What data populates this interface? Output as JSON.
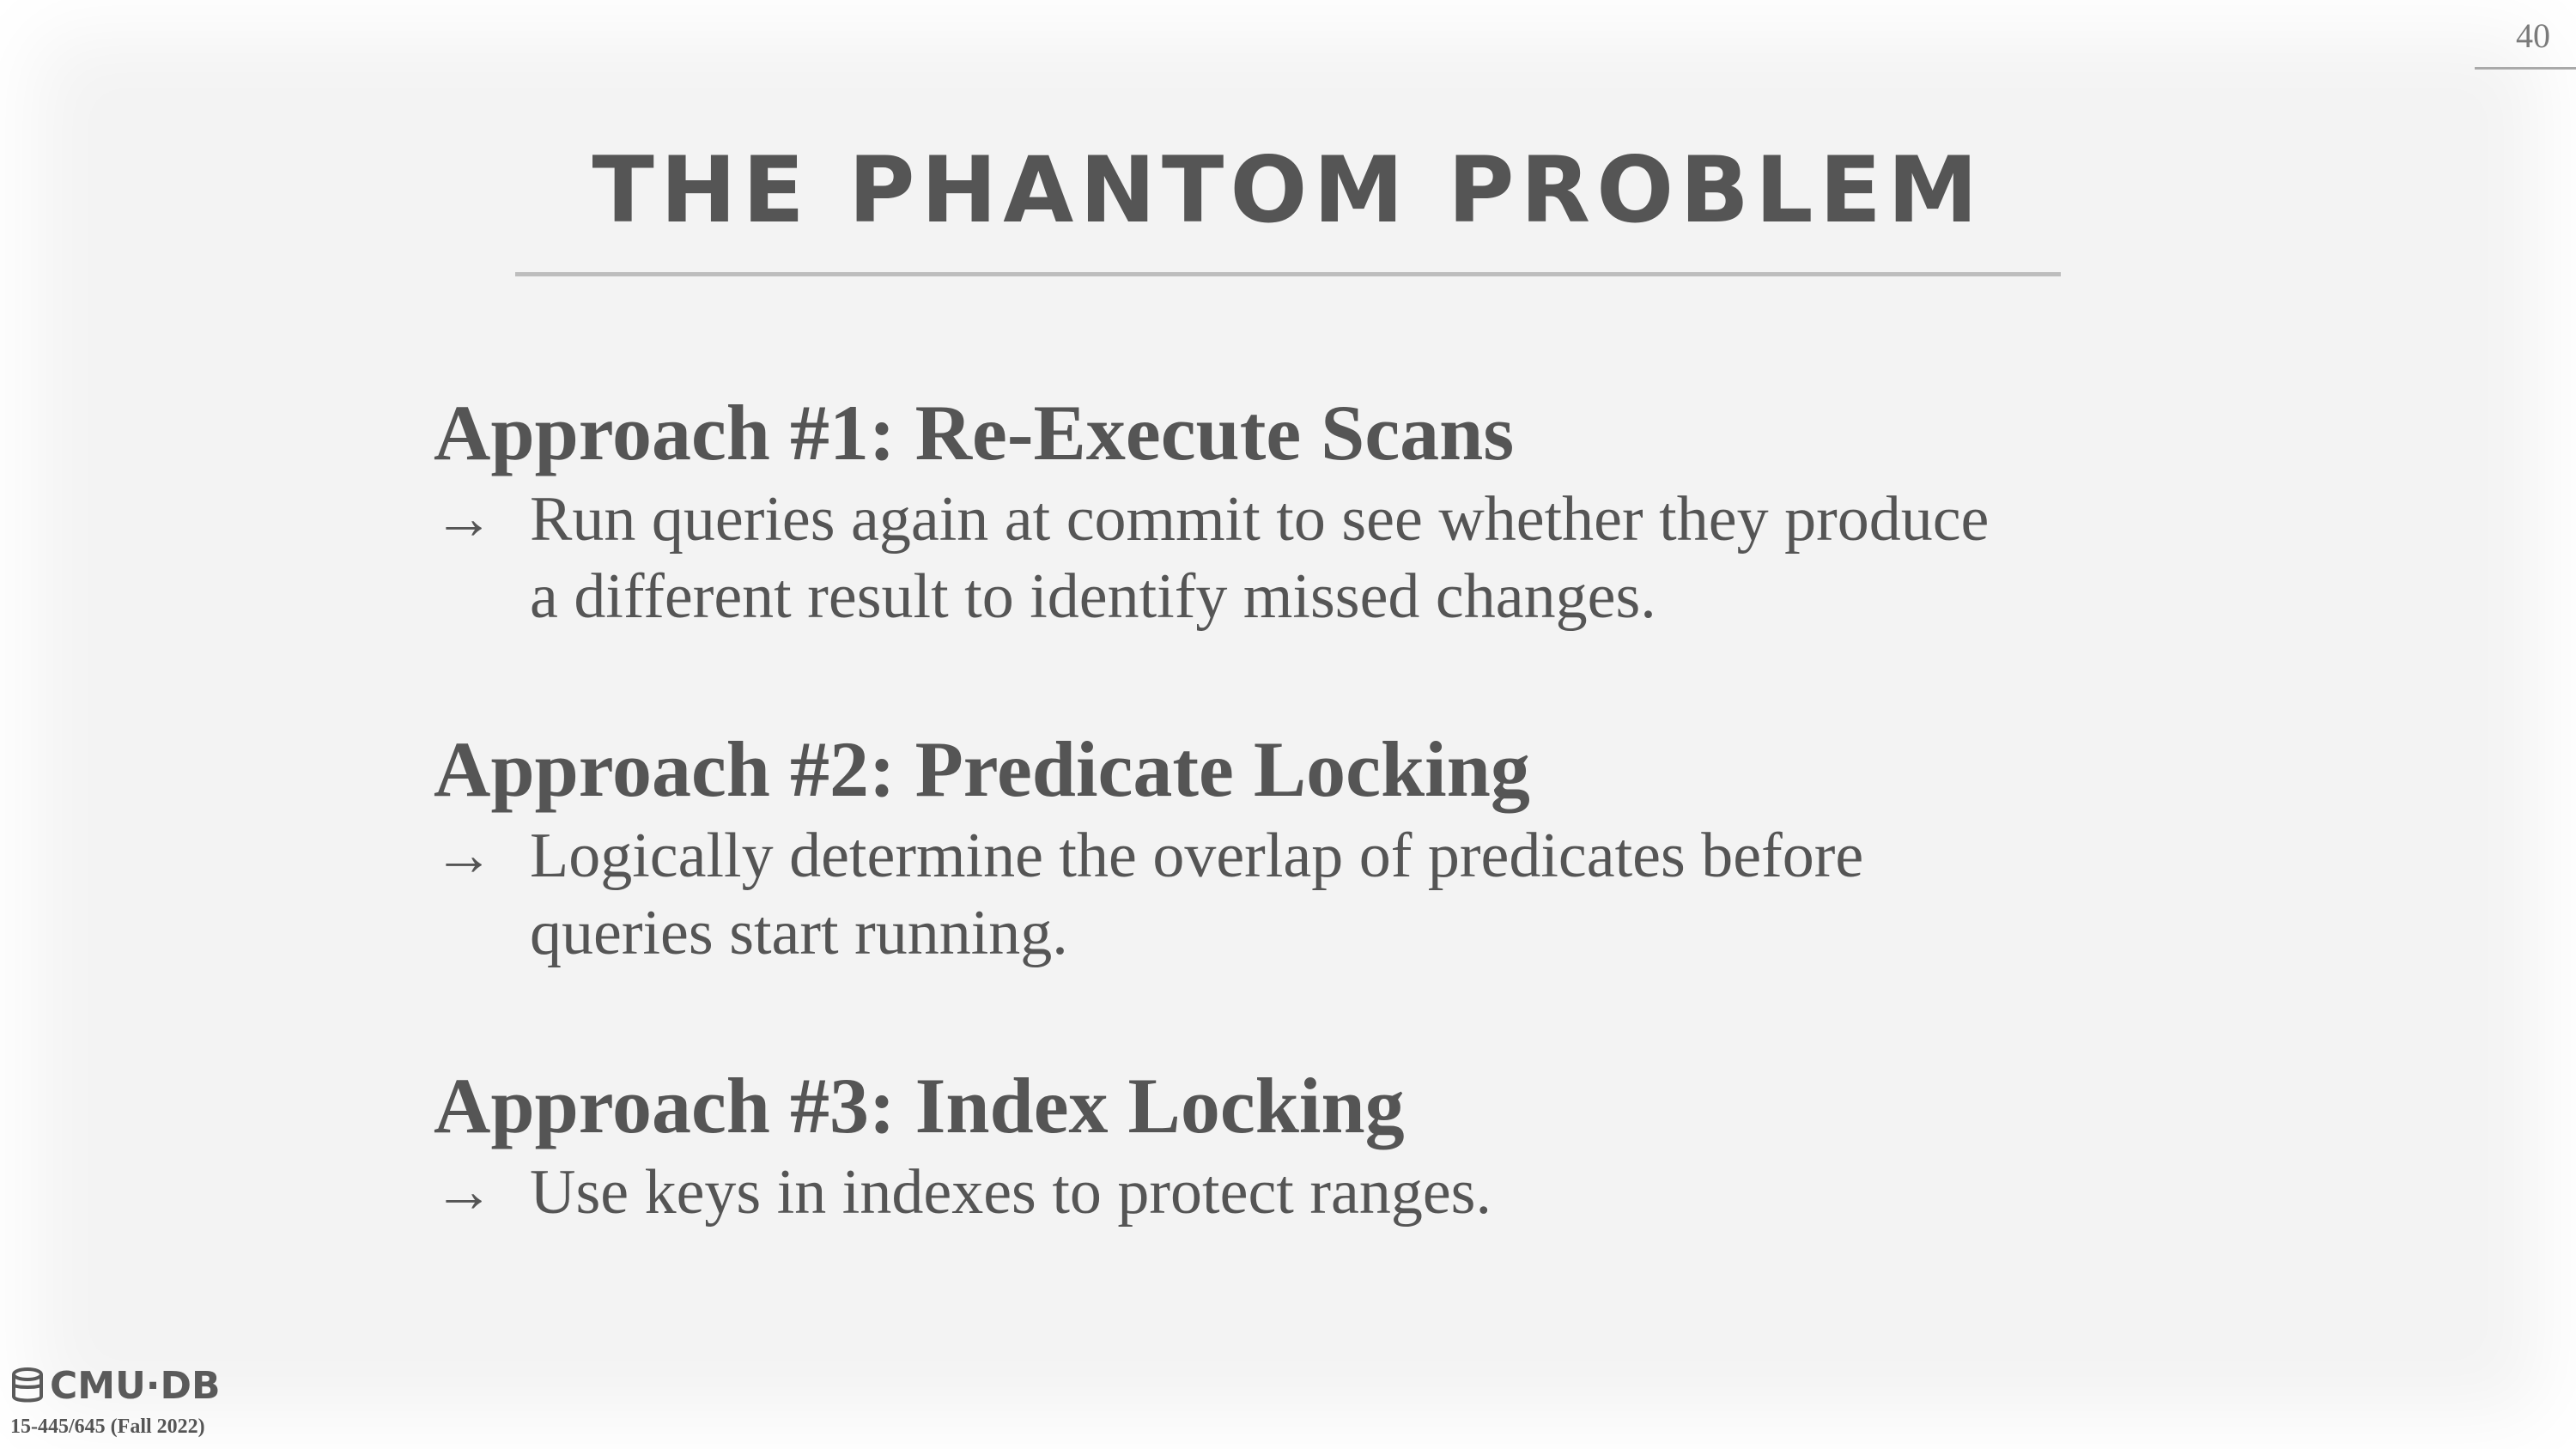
{
  "page_number": "40",
  "title": "THE PHANTOM PROBLEM",
  "approaches": [
    {
      "heading": "Approach #1: Re-Execute Scans",
      "bullet_lines": [
        "Run queries again at commit to see whether they produce",
        "a different result to identify missed changes."
      ]
    },
    {
      "heading": "Approach #2: Predicate Locking",
      "bullet_lines": [
        "Logically determine the overlap of predicates before",
        "queries start running."
      ]
    },
    {
      "heading": "Approach #3: Index Locking",
      "bullet_lines": [
        "Use keys in indexes to protect ranges."
      ]
    }
  ],
  "arrow_glyph": "→",
  "footer": {
    "logo_text": "CMU·DB",
    "logo_icon": "database-icon",
    "course": "15-445/645 (Fall 2022)"
  },
  "colors": {
    "text": "#555555",
    "background": "#f3f3f3",
    "rule": "#bdbdbd"
  }
}
